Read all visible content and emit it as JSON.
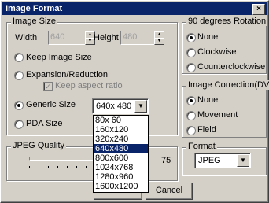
{
  "window": {
    "title": "Image Format",
    "close_label": "×"
  },
  "image_size": {
    "legend": "Image Size",
    "width_label": "Width",
    "width_value": "640",
    "height_label": "Height",
    "height_value": "480",
    "keep_label": "Keep Image Size",
    "expansion_label": "Expansion/Reduction",
    "keep_aspect_label": "Keep aspect ratio",
    "generic_label": "Generic Size",
    "generic_value": "640x 480",
    "pda_label": "PDA Size"
  },
  "size_options": [
    "80x 60",
    "160x120",
    "320x240",
    "640x480",
    "800x600",
    "1024x768",
    "1280x960",
    "1600x1200"
  ],
  "selected_size_index": 3,
  "jpeg_quality": {
    "legend": "JPEG Quality",
    "value": "75"
  },
  "rotation": {
    "legend": "90 degrees Rotation",
    "options": [
      "None",
      "Clockwise",
      "Counterclockwise"
    ],
    "selected": 0
  },
  "correction": {
    "legend": "Image Correction(DV)",
    "options": [
      "None",
      "Movement",
      "Field"
    ],
    "selected": 0
  },
  "format": {
    "legend": "Format",
    "value": "JPEG"
  },
  "buttons": {
    "cancel": "Cancel"
  }
}
